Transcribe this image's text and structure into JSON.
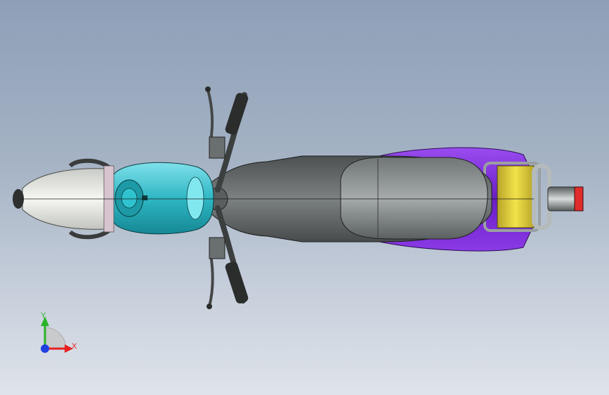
{
  "viewport": {
    "background_top": "#8e9fb7",
    "background_bottom": "#dfe4ea",
    "model": "motorcycle-top-view"
  },
  "colors": {
    "fuel_tank": "#2fb7c4",
    "body_panel": "#7a2bd6",
    "luggage_rack": "#e3d23a",
    "seat_frame": "#6a6e70",
    "seat": "#8d9292",
    "fairing": "#eef0ea",
    "tail_light": "#e02b2b",
    "axis_x": "#e62020",
    "axis_y": "#2bb32b",
    "axis_z": "#2040e0"
  },
  "triad": {
    "x_label": "X",
    "y_label": "Y"
  }
}
